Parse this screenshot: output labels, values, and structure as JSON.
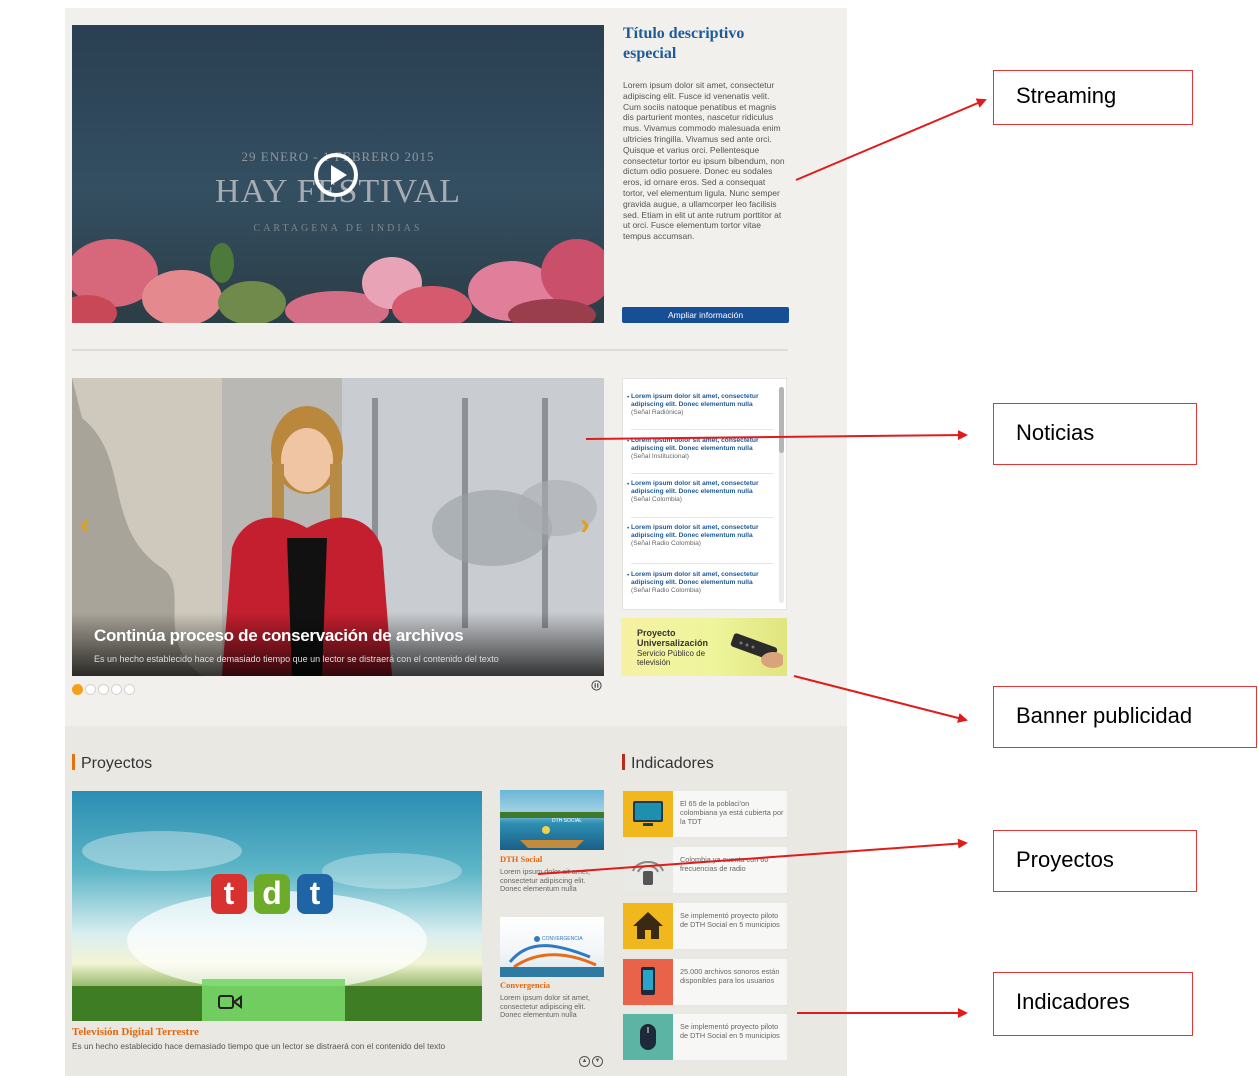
{
  "streaming": {
    "video": {
      "date_text": "29 ENERO - 1 FEBRERO 2015",
      "event_name": "HAY FESTIVAL",
      "event_place": "CARTAGENA DE INDIAS"
    },
    "title": "Título descriptivo especial",
    "description": "Lorem ipsum dolor sit amet, consectetur adipiscing elit. Fusce id venenatis velit. Cum sociis natoque penatibus et magnis dis parturient montes, nascetur ridiculus mus. Vivamus commodo malesuada enim ultricies fringilla. Vivamus sed ante orci. Quisque et varius orci. Pellentesque consectetur tortor eu ipsum bibendum, non dictum odio posuere. Donec eu sodales eros, id ornare eros. Sed a consequat tortor, vel elementum ligula. Nunc semper gravida augue, a ullamcorper leo facilisis sed. Etiam in elit ut ante rutrum porttitor at ut orci. Fusce elementum tortor vitae tempus accumsan.",
    "more_button": "Ampliar información"
  },
  "news": {
    "headline": "Continúa proceso de conservación de archivos",
    "subtext": "Es un hecho establecido hace demasiado tiempo que un lector se distraerá con el contenido del texto",
    "slides_total": 5,
    "active_slide": 1,
    "items": [
      {
        "title": "Lorem ipsum dolor sit amet, consectetur adipiscing elit. Donec elementum nulla",
        "source": "(Señal Radiónica)"
      },
      {
        "title": "Lorem ipsum dolor sit amet, consectetur adipiscing elit. Donec elementum nulla",
        "source": "(Señal Institucional)"
      },
      {
        "title": "Lorem ipsum dolor sit amet, consectetur adipiscing elit. Donec elementum nulla",
        "source": "(Señal Colombia)"
      },
      {
        "title": "Lorem ipsum dolor sit amet, consectetur adipiscing elit. Donec elementum nulla",
        "source": "(Señal Radio Colombia)"
      },
      {
        "title": "Lorem ipsum dolor sit amet, consectetur adipiscing elit. Donec elementum nulla",
        "source": "(Señal Radio Colombia)"
      }
    ]
  },
  "banner": {
    "line1": "Proyecto",
    "line2": "Universalización",
    "line3": "Servicio Público de televisión"
  },
  "projects": {
    "section_title": "Proyectos",
    "main": {
      "logo_letters": [
        "t",
        "d",
        "t"
      ],
      "title": "Televisión Digital Terrestre",
      "description": "Es un hecho establecido hace demasiado tiempo que un lector se distraerá con el contenido del texto"
    },
    "items": [
      {
        "title": "DTH Social",
        "thumb_label": "DTH SOCIAL",
        "description": "Lorem ipsum dolor sit amet, consectetur adipiscing elit. Donec elementum nulla"
      },
      {
        "title": "Convergencia",
        "thumb_label": "CONVERGENCIA",
        "description": "Lorem ipsum dolor sit amet, consectetur adipiscing elit. Donec elementum nulla"
      }
    ]
  },
  "indicators": {
    "section_title": "Indicadores",
    "items": [
      {
        "icon": "tv-icon",
        "color": "#f0b81d",
        "text": "El 65 de la poblaci'on colombiana ya está cubierta por la TDT"
      },
      {
        "icon": "radio-signal-icon",
        "color": "#e9e9e6",
        "text": "Colombia ya cuenta con 60 frecuencias de radio"
      },
      {
        "icon": "house-icon",
        "color": "#f0b81d",
        "text": "Se implementó proyecto piloto de DTH Social en 5 municipios"
      },
      {
        "icon": "smartphone-icon",
        "color": "#e9634a",
        "text": "25.000 archivos sonoros están disponibles para los usuarios"
      },
      {
        "icon": "mouse-icon",
        "color": "#5cb5a4",
        "text": "Se implementó proyecto piloto de DTH Social en 5 municipios"
      }
    ]
  },
  "annotations": {
    "streaming": "Streaming",
    "noticias": "Noticias",
    "banner": "Banner publicidad",
    "proyectos": "Proyectos",
    "indicadores": "Indicadores"
  },
  "colors": {
    "brand_blue": "#164f96",
    "accent_orange": "#e8710f",
    "annotation_red": "#e03636"
  }
}
